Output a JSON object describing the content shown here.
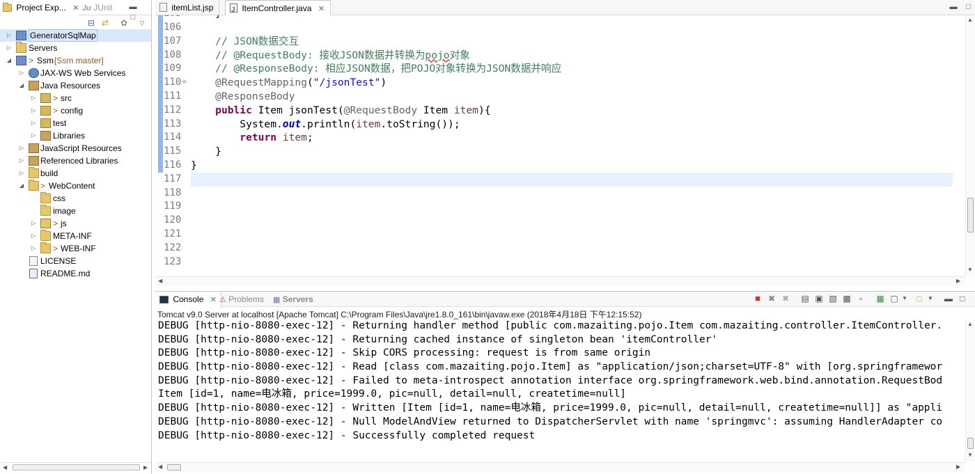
{
  "left": {
    "tabs": [
      {
        "label": "Project Exp...",
        "icon": "project-explorer-icon",
        "close": "✕"
      },
      {
        "label": "JUnit",
        "icon": "junit-icon"
      }
    ],
    "tree": [
      {
        "label": "GeneratorSqlMap",
        "prefix": "",
        "suffix": "",
        "icon": "project-icon",
        "twisty": "▷"
      },
      {
        "label": "Servers",
        "prefix": "",
        "suffix": "",
        "icon": "folder-icon",
        "twisty": "▷"
      },
      {
        "label": "Ssm",
        "prefix": "> ",
        "suffix": "[Ssm master]",
        "icon": "project-icon",
        "twisty": "◢"
      },
      {
        "label": "JAX-WS Web Services",
        "prefix": "",
        "suffix": "",
        "icon": "webservices-icon",
        "twisty": "▷"
      },
      {
        "label": "Java Resources",
        "prefix": "",
        "suffix": "",
        "icon": "java-resources-icon",
        "twisty": "◢"
      },
      {
        "label": "src",
        "prefix": "> ",
        "suffix": "",
        "icon": "source-folder-icon",
        "twisty": "▷"
      },
      {
        "label": "config",
        "prefix": "> ",
        "suffix": "",
        "icon": "source-folder-icon",
        "twisty": "▷"
      },
      {
        "label": "test",
        "prefix": "",
        "suffix": "",
        "icon": "source-folder-icon",
        "twisty": "▷"
      },
      {
        "label": "Libraries",
        "prefix": "",
        "suffix": "",
        "icon": "libraries-icon",
        "twisty": "▷"
      },
      {
        "label": "JavaScript Resources",
        "prefix": "",
        "suffix": "",
        "icon": "javascript-resources-icon",
        "twisty": "▷"
      },
      {
        "label": "Referenced Libraries",
        "prefix": "",
        "suffix": "",
        "icon": "referenced-libraries-icon",
        "twisty": "▷"
      },
      {
        "label": "build",
        "prefix": "",
        "suffix": "",
        "icon": "folder-icon",
        "twisty": "▷"
      },
      {
        "label": "WebContent",
        "prefix": "> ",
        "suffix": "",
        "icon": "folder-icon",
        "twisty": "◢"
      },
      {
        "label": "css",
        "prefix": "",
        "suffix": "",
        "icon": "folder-icon",
        "twisty": ""
      },
      {
        "label": "image",
        "prefix": "",
        "suffix": "",
        "icon": "folder-icon",
        "twisty": ""
      },
      {
        "label": "js",
        "prefix": "> ",
        "suffix": "",
        "icon": "folder-icon",
        "twisty": "▷"
      },
      {
        "label": "META-INF",
        "prefix": "",
        "suffix": "",
        "icon": "folder-icon",
        "twisty": "▷"
      },
      {
        "label": "WEB-INF",
        "prefix": "> ",
        "suffix": "",
        "icon": "folder-icon",
        "twisty": "▷"
      },
      {
        "label": "LICENSE",
        "prefix": "",
        "suffix": "",
        "icon": "file-icon",
        "twisty": ""
      },
      {
        "label": "README.md",
        "prefix": "",
        "suffix": "",
        "icon": "markdown-file-icon",
        "twisty": ""
      }
    ]
  },
  "editor": {
    "tabs": [
      {
        "label": "itemList.jsp",
        "icon": "jsp-file-icon",
        "active": false
      },
      {
        "label": "ItemController.java",
        "icon": "java-file-icon",
        "active": true,
        "close": "✕"
      }
    ],
    "top_partial_line": "}",
    "line_numbers": [
      "106",
      "107",
      "108",
      "109",
      "110",
      "111",
      "112",
      "113",
      "114",
      "115",
      "116",
      "117",
      "118",
      "119",
      "120",
      "121",
      "122",
      "123"
    ],
    "lines": [
      "",
      "    // JSON数据交互",
      "    // @RequestBody: 接收JSON数据并转换为pojo对象",
      "    // @ResponseBody: 相应JSON数据，把POJO对象转换为JSON数据并响应",
      "    @RequestMapping(\"/jsonTest\")",
      "    @ResponseBody",
      "    public Item jsonTest(@RequestBody Item item){",
      "        System.out.println(item.toString());",
      "        return item;",
      "    }",
      "}",
      "",
      "",
      "",
      "",
      "",
      "",
      ""
    ],
    "current_line": "117"
  },
  "console": {
    "tabs": [
      {
        "label": "Console",
        "icon": "console-icon",
        "active": true,
        "close": "✕"
      },
      {
        "label": "Problems",
        "icon": "problems-icon",
        "active": false
      },
      {
        "label": "Servers",
        "icon": "servers-icon",
        "active": false
      }
    ],
    "description": "Tomcat v9.0 Server at localhost [Apache Tomcat] C:\\Program Files\\Java\\jre1.8.0_161\\bin\\javaw.exe (2018年4月18日 下午12:15:52)",
    "lines": [
      "DEBUG [http-nio-8080-exec-12] - Returning handler method [public com.mazaiting.pojo.Item com.mazaiting.controller.ItemController.",
      "DEBUG [http-nio-8080-exec-12] - Returning cached instance of singleton bean 'itemController'",
      "DEBUG [http-nio-8080-exec-12] - Skip CORS processing: request is from same origin",
      "DEBUG [http-nio-8080-exec-12] - Read [class com.mazaiting.pojo.Item] as \"application/json;charset=UTF-8\" with [org.springframewor",
      "DEBUG [http-nio-8080-exec-12] - Failed to meta-introspect annotation interface org.springframework.web.bind.annotation.RequestBod",
      "Item [id=1, name=电冰箱, price=1999.0, pic=null, detail=null, createtime=null]",
      "DEBUG [http-nio-8080-exec-12] - Written [Item [id=1, name=电冰箱, price=1999.0, pic=null, detail=null, createtime=null]] as \"appli",
      "DEBUG [http-nio-8080-exec-12] - Null ModelAndView returned to DispatcherServlet with name 'springmvc': assuming HandlerAdapter co",
      "DEBUG [http-nio-8080-exec-12] - Successfully completed request"
    ]
  },
  "colors": {
    "comment": "#3f7f5f",
    "keyword": "#7f0055",
    "string": "#2a00ff",
    "annotation": "#646464",
    "variable": "#6a3e3e",
    "field": "#0000c0",
    "current_line_bg": "#e8f2fe",
    "terminate_red": "#d9342b"
  }
}
